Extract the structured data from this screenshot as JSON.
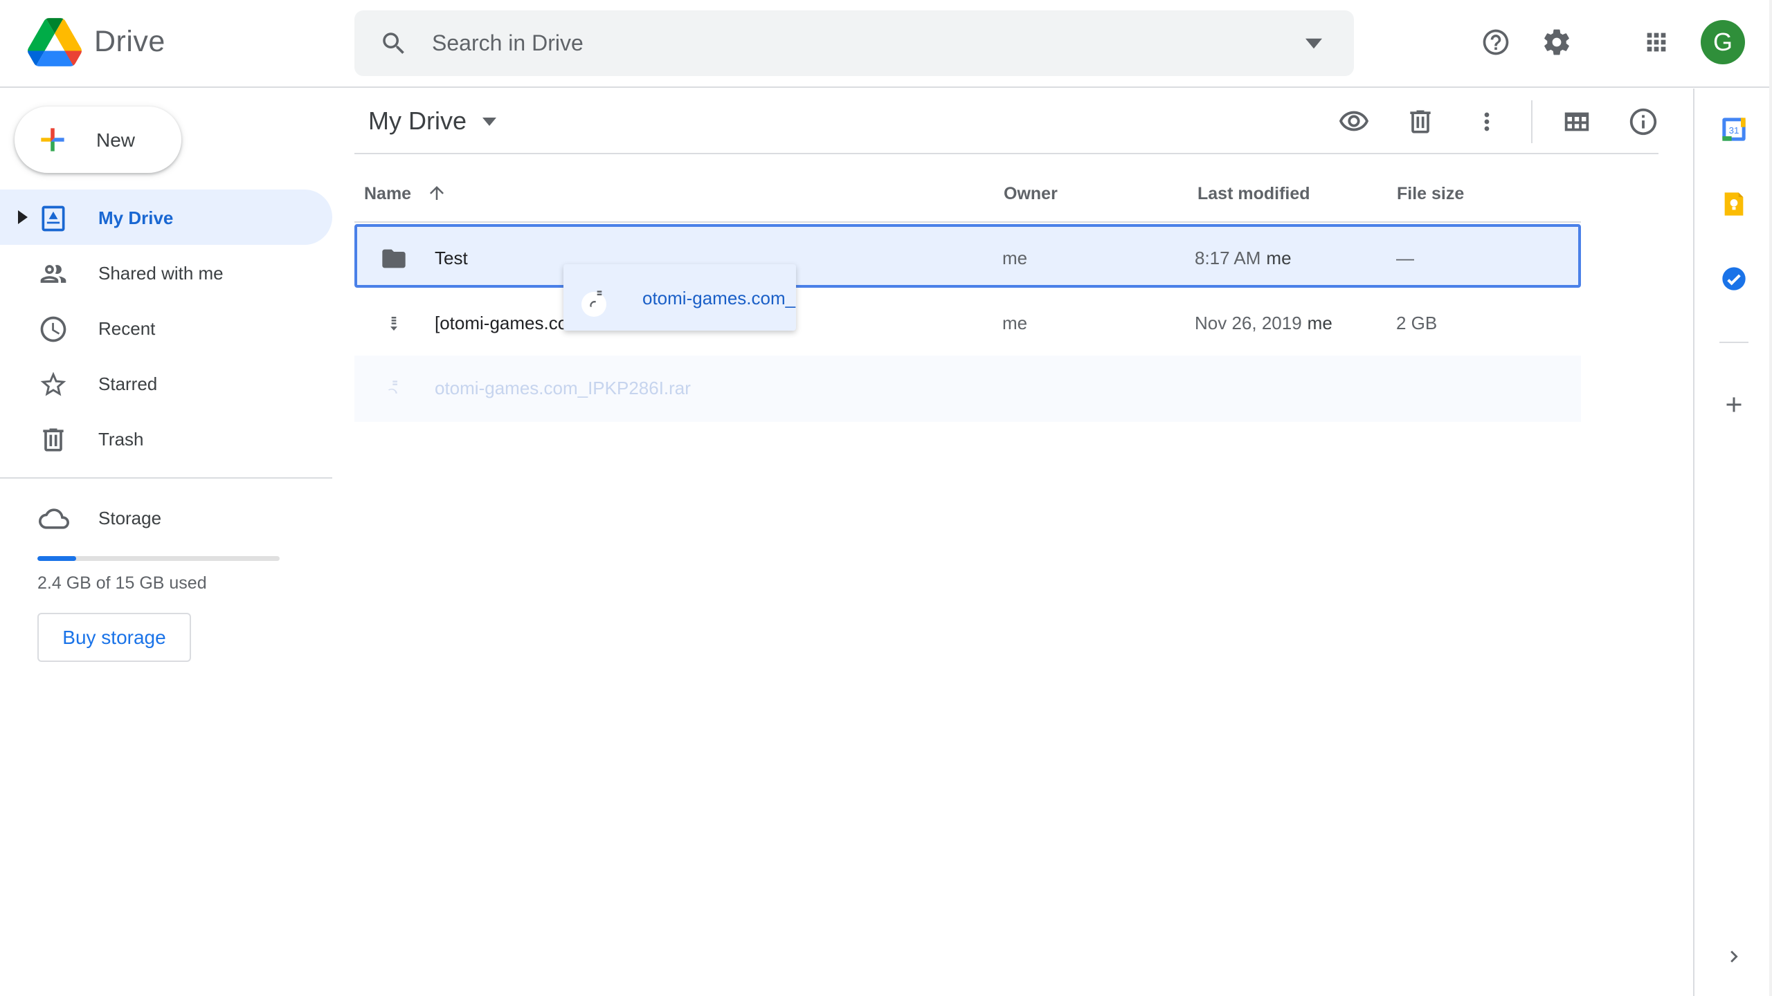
{
  "app": {
    "brand": "Drive"
  },
  "search": {
    "placeholder": "Search in Drive"
  },
  "header": {
    "avatar_initial": "G"
  },
  "sidebar": {
    "new_label": "New",
    "items": [
      {
        "label": "My Drive",
        "icon": "my-drive-icon",
        "active": true
      },
      {
        "label": "Shared with me",
        "icon": "people-icon"
      },
      {
        "label": "Recent",
        "icon": "clock-icon"
      },
      {
        "label": "Starred",
        "icon": "star-icon"
      },
      {
        "label": "Trash",
        "icon": "trash-icon"
      }
    ],
    "storage": {
      "label": "Storage",
      "used_text": "2.4 GB of 15 GB used",
      "used_fraction": 0.16,
      "buy_label": "Buy storage"
    }
  },
  "main": {
    "title": "My Drive",
    "columns": {
      "name": "Name",
      "owner": "Owner",
      "last_modified": "Last modified",
      "file_size": "File size"
    },
    "rows": [
      {
        "type": "folder",
        "name": "Test",
        "owner": "me",
        "modified": "8:17 AM",
        "modified_by": "me",
        "size": "—"
      },
      {
        "type": "archive",
        "name": "[otomi-games.co",
        "owner": "me",
        "modified": "Nov 26, 2019",
        "modified_by": "me",
        "size": "2 GB"
      }
    ],
    "uploading": {
      "name": "otomi-games.com_IPKP286I.rar"
    },
    "drag_chip": {
      "name": "otomi-games.com_"
    }
  },
  "colors": {
    "accent": "#1a73e8",
    "active_bg": "#e8f0fe",
    "avatar": "#2f8f3a"
  }
}
